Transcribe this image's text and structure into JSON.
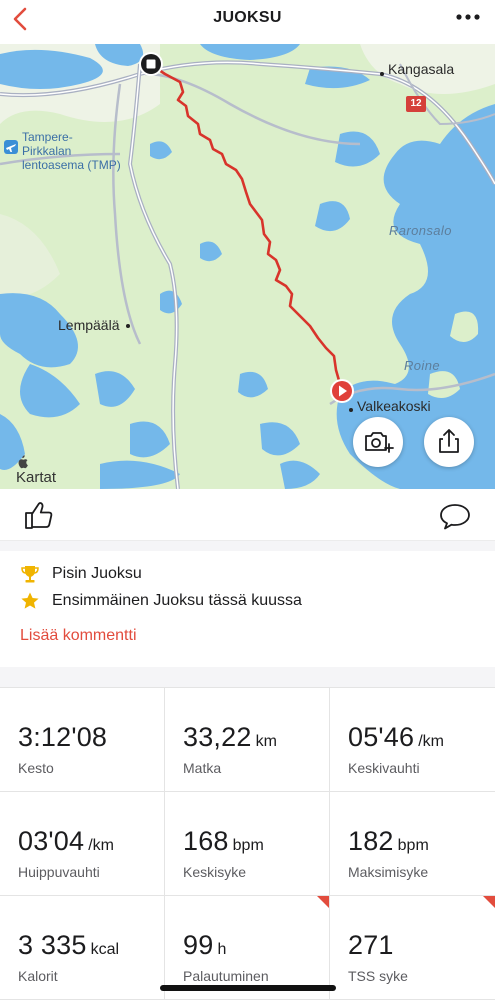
{
  "header": {
    "title": "JUOKSU"
  },
  "map": {
    "labels": {
      "kangasala": "Kangasala",
      "airport_line1": "Tampere-",
      "airport_line2": "Pirkkalan",
      "airport_line3": "lentoasema (TMP)",
      "raronsalo": "Raronsalo",
      "lempaala": "Lempäälä",
      "roine": "Roine",
      "valkeakoski": "Valkeakoski",
      "road_number": "12"
    },
    "attribution": "Kartat",
    "route_color": "#d8342b"
  },
  "achievements": [
    {
      "icon": "trophy-icon",
      "text": "Pisin Juoksu"
    },
    {
      "icon": "star-icon",
      "text": "Ensimmäinen Juoksu tässä kuussa"
    }
  ],
  "add_comment": "Lisää kommentti",
  "stats": [
    {
      "value": "3:12'08",
      "unit": "",
      "label": "Kesto"
    },
    {
      "value": "33,22",
      "unit": "km",
      "label": "Matka"
    },
    {
      "value": "05'46",
      "unit": "/km",
      "label": "Keskivauhti"
    },
    {
      "value": "03'04",
      "unit": "/km",
      "label": "Huippuvauhti"
    },
    {
      "value": "168",
      "unit": "bpm",
      "label": "Keskisyke"
    },
    {
      "value": "182",
      "unit": "bpm",
      "label": "Maksimisyke"
    },
    {
      "value": "3 335",
      "unit": "kcal",
      "label": "Kalorit"
    },
    {
      "value": "99",
      "unit": "h",
      "label": "Palautuminen"
    },
    {
      "value": "271",
      "unit": "",
      "label": "TSS syke"
    }
  ],
  "colors": {
    "accent": "#e24c3d",
    "water": "#74b8ea",
    "land": "#dcefcb"
  }
}
